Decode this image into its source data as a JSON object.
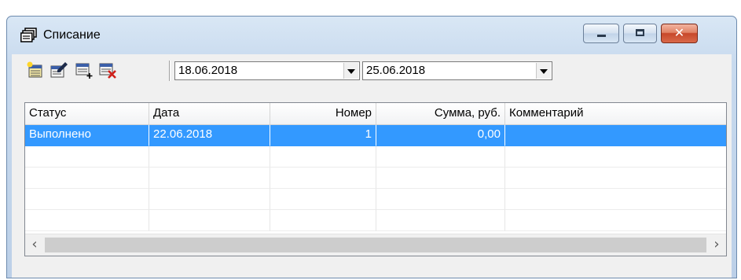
{
  "window": {
    "title": "Списание",
    "icon": "stack-of-cards-icon",
    "buttons": {
      "minimize": "minimize-icon",
      "maximize": "maximize-icon",
      "close": "close-icon"
    }
  },
  "toolbar": {
    "buttons": [
      {
        "name": "add-document-icon",
        "hint": "new"
      },
      {
        "name": "edit-document-icon",
        "hint": "edit"
      },
      {
        "name": "add-row-icon",
        "hint": "add"
      },
      {
        "name": "delete-document-icon",
        "hint": "delete"
      }
    ],
    "date_from": "18.06.2018",
    "date_to": "25.06.2018"
  },
  "table": {
    "columns": [
      "Статус",
      "Дата",
      "Номер",
      "Сумма, руб.",
      "Комментарий"
    ],
    "rows": [
      {
        "status": "Выполнено",
        "date": "22.06.2018",
        "number": "1",
        "sum": "0,00",
        "comment": "",
        "selected": true
      }
    ]
  },
  "colors": {
    "selection": "#3399ff",
    "close_button": "#c7472a",
    "title_gradient": "#d9e7f5"
  }
}
